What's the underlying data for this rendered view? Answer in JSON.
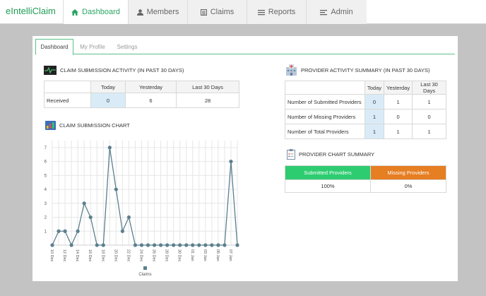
{
  "app": {
    "title": "eIntelliClaim"
  },
  "nav": [
    {
      "label": "Dashboard",
      "icon": "home-icon",
      "active": true
    },
    {
      "label": "Members",
      "icon": "user-icon",
      "active": false
    },
    {
      "label": "Claims",
      "icon": "list-icon",
      "active": false
    },
    {
      "label": "Reports",
      "icon": "reports-icon",
      "active": false
    },
    {
      "label": "Admin",
      "icon": "admin-icon",
      "active": false
    }
  ],
  "tabs": [
    {
      "label": "Dashboard",
      "active": true
    },
    {
      "label": "My Profile",
      "active": false
    },
    {
      "label": "Settings",
      "active": false
    }
  ],
  "claim_activity": {
    "title": "CLAIM SUBMISSION ACTIVITY (IN PAST 30 DAYS)",
    "icon": "heartbeat-monitor-icon",
    "headers": [
      "",
      "Today",
      "Yesterday",
      "Last 30 Days"
    ],
    "rows": [
      {
        "label": "Received",
        "today": "0",
        "yesterday": "6",
        "last30": "28"
      }
    ]
  },
  "provider_activity": {
    "title": "PROVIDER ACTIVITY SUMMARY (IN PAST 30 DAYS)",
    "icon": "hospital-building-icon",
    "headers": [
      "",
      "Today",
      "Yesterday",
      "Last 30 Days"
    ],
    "rows": [
      {
        "label": "Number of Submitted Providers",
        "today": "0",
        "yesterday": "1",
        "last30": "1"
      },
      {
        "label": "Number of Missing Providers",
        "today": "1",
        "yesterday": "0",
        "last30": "0"
      },
      {
        "label": "Number of Total Providers",
        "today": "1",
        "yesterday": "1",
        "last30": "1"
      }
    ]
  },
  "provider_chart": {
    "title": "PROVIDER CHART SUMMARY",
    "icon": "clipboard-chart-icon",
    "submitted_label": "Submitted Providers",
    "missing_label": "Missing Providers",
    "submitted_value": "100%",
    "missing_value": "0%",
    "submitted_color": "#2ecc71",
    "missing_color": "#e67e22"
  },
  "claim_chart_title": "CLAIM SUBMISSION CHART",
  "claim_chart_icon": "bar-chart-icon",
  "chart_data": {
    "type": "line",
    "title": "",
    "xlabel": "",
    "ylabel": "",
    "x": [
      "10 Dec",
      "11 Dec",
      "12 Dec",
      "13 Dec",
      "14 Dec",
      "15 Dec",
      "16 Dec",
      "17 Dec",
      "18 Dec",
      "19 Dec",
      "20 Dec",
      "21 Dec",
      "22 Dec",
      "23 Dec",
      "24 Dec",
      "25 Dec",
      "26 Dec",
      "27 Dec",
      "28 Dec",
      "29 Dec",
      "30 Dec",
      "31 Dec",
      "01 Jan",
      "02 Jan",
      "03 Jan",
      "04 Jan",
      "05 Jan",
      "06 Jan",
      "07 Jan",
      "08 Jan"
    ],
    "x_tick_labels": [
      "10 Dec",
      "12 Dec",
      "14 Dec",
      "16 Dec",
      "18 Dec",
      "20 Dec",
      "22 Dec",
      "24 Dec",
      "26 Dec",
      "28 Dec",
      "30 Dec",
      "01 Jan",
      "03 Jan",
      "05 Jan",
      "07 Jan"
    ],
    "series": [
      {
        "name": "Claims",
        "values": [
          0,
          1,
          1,
          0,
          1,
          3,
          2,
          0,
          0,
          7,
          4,
          1,
          2,
          0,
          0,
          0,
          0,
          0,
          0,
          0,
          0,
          0,
          0,
          0,
          0,
          0,
          0,
          0,
          6,
          0
        ]
      }
    ],
    "yticks": [
      1,
      2,
      3,
      4,
      5,
      6,
      7
    ],
    "ylim": [
      0,
      7.5
    ],
    "grid": true,
    "legend": "bottom-center",
    "color": "#5b7f8e"
  }
}
